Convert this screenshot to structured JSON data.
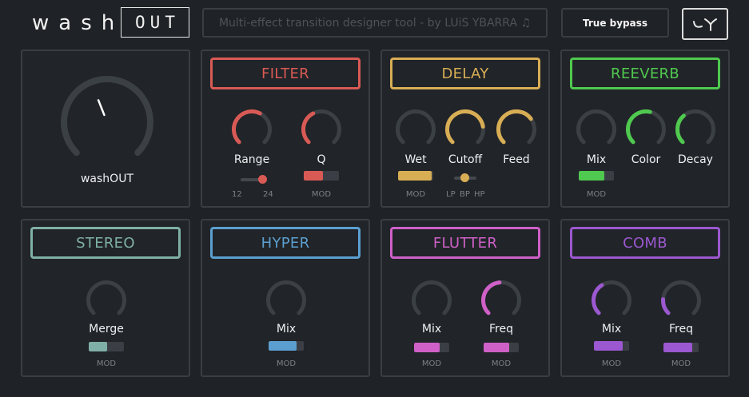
{
  "header": {
    "logo_left": "wash",
    "logo_right": "OUT",
    "subtitle": "Multi-effect transition designer tool - by LUiS YBARRA ♫",
    "bypass_label": "True bypass"
  },
  "main": {
    "label": "washOUT",
    "value": 0.42
  },
  "modules": {
    "filter": {
      "title": "FILTER",
      "color": "#d95a55",
      "knobs": [
        {
          "label": "Range",
          "value": 0.6
        },
        {
          "label": "Q",
          "value": 0.4
        }
      ],
      "range_slider": {
        "min_label": "12",
        "max_label": "24",
        "value": 1.0
      },
      "mod_label": "MOD",
      "mod_value": 0.55
    },
    "delay": {
      "title": "DELAY",
      "color": "#d8ae55",
      "knobs": [
        {
          "label": "Wet",
          "value": 0.0
        },
        {
          "label": "Cutoff",
          "value": 0.8
        },
        {
          "label": "Feed",
          "value": 0.7
        }
      ],
      "mod_label": "MOD",
      "mod_value": 0.95,
      "filter_mode": {
        "options": [
          "LP",
          "BP",
          "HP"
        ],
        "value": "BP"
      }
    },
    "reeverb": {
      "title": "REEVERB",
      "color": "#4fc94f",
      "knobs": [
        {
          "label": "Mix",
          "value": 0.0
        },
        {
          "label": "Color",
          "value": 0.55
        },
        {
          "label": "Decay",
          "value": 0.35
        }
      ],
      "mod_label": "MOD",
      "mod_value": 0.72
    },
    "stereo": {
      "title": "STEREO",
      "color": "#7fb0a8",
      "knobs": [
        {
          "label": "Merge",
          "value": 0.0
        }
      ],
      "mod_label": "MOD",
      "mod_value": 0.52
    },
    "hyper": {
      "title": "HYPER",
      "color": "#5b9fd0",
      "knobs": [
        {
          "label": "Mix",
          "value": 0.0
        }
      ],
      "mod_label": "MOD",
      "mod_value": 0.8
    },
    "flutter": {
      "title": "FLUTTER",
      "color": "#cf60c8",
      "knobs": [
        {
          "label": "Mix",
          "value": 0.0
        },
        {
          "label": "Freq",
          "value": 0.48
        }
      ],
      "mod_label": "MOD",
      "mod_value": 0.72
    },
    "comb": {
      "title": "COMB",
      "color": "#9b58d0",
      "knobs": [
        {
          "label": "Mix",
          "value": 0.38
        },
        {
          "label": "Freq",
          "value": 0.18
        }
      ],
      "mod_label": "MOD",
      "mod_value": 0.82
    }
  }
}
